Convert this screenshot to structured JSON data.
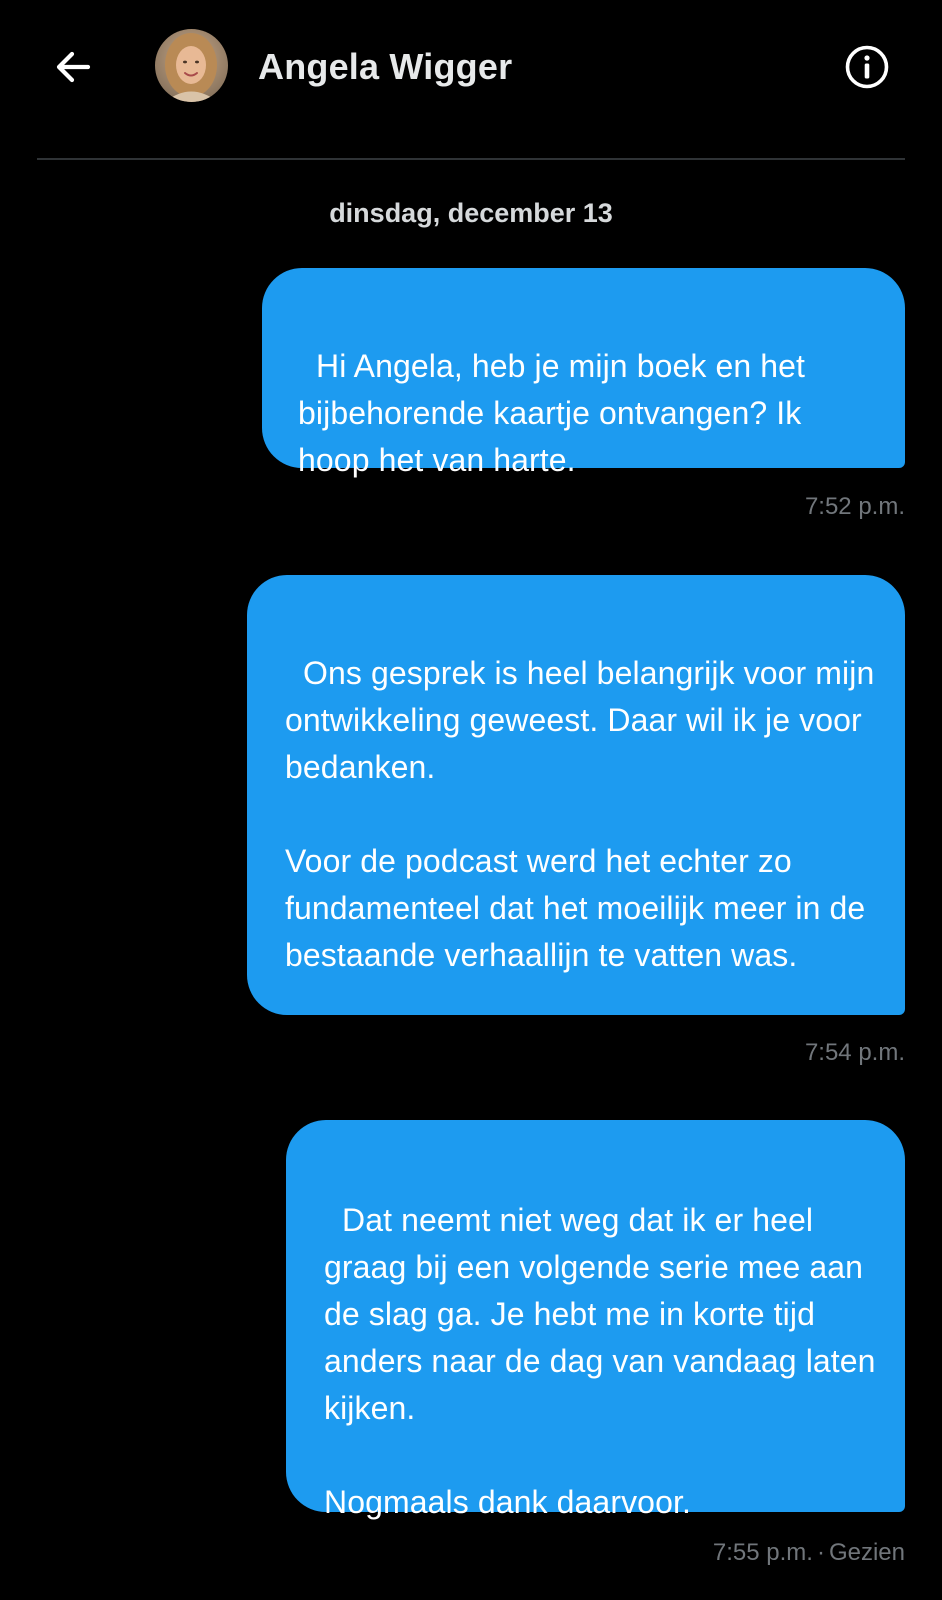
{
  "header": {
    "contact_name": "Angela Wigger",
    "back_icon": "arrow-left-icon",
    "info_icon": "info-icon"
  },
  "date_separator": "dinsdag, december 13",
  "messages": [
    {
      "text": "Hi Angela, heb je mijn boek en het bijbehorende kaartje ontvangen? Ik hoop het van harte.",
      "time": "7:52 p.m."
    },
    {
      "text": "Ons gesprek is heel belangrijk voor mijn ontwikkeling geweest. Daar wil ik je voor bedanken.\n\nVoor de podcast werd het echter zo fundamenteel dat het moeilijk meer in de bestaande verhaallijn te vatten was.",
      "time": "7:54 p.m."
    },
    {
      "text": "Dat neemt niet weg dat ik er heel graag bij een volgende serie mee aan de slag ga. Je hebt me in korte tijd anders naar de dag van vandaag laten kijken.\n\nNogmaals dank daarvoor.",
      "time": "7:55 p.m.",
      "status": "Gezien"
    }
  ],
  "colors": {
    "background": "#000000",
    "bubble": "#1d9bf0",
    "meta_text": "#71767b",
    "divider": "#2f3336"
  }
}
